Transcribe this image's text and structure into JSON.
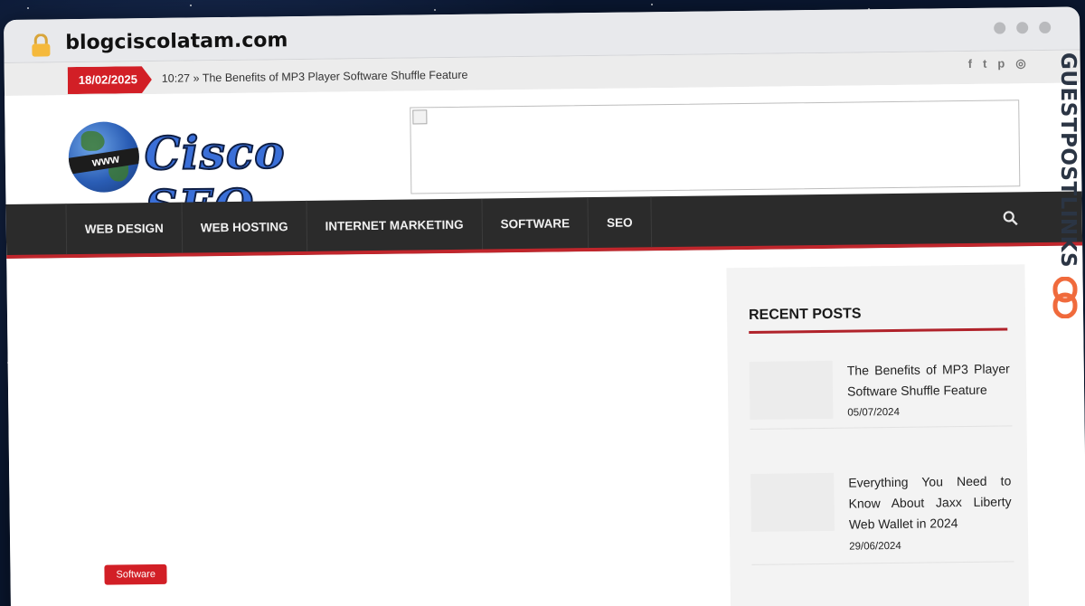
{
  "browser": {
    "domain": "blogciscolatam.com"
  },
  "topbar": {
    "date": "18/02/2025",
    "ticker_time": "10:27",
    "ticker_text": "The Benefits of MP3 Player Software Shuffle Feature",
    "social_icons": [
      "facebook-icon",
      "twitter-icon",
      "pinterest-icon",
      "instagram-icon"
    ]
  },
  "logo": {
    "globe_text": "www",
    "text": "Cisco SEO"
  },
  "nav": {
    "items": [
      {
        "label": "WEB DESIGN"
      },
      {
        "label": "WEB HOSTING"
      },
      {
        "label": "INTERNET MARKETING"
      },
      {
        "label": "SOFTWARE"
      },
      {
        "label": "SEO"
      }
    ]
  },
  "main": {
    "category_tag": "Software"
  },
  "sidebar": {
    "title": "RECENT POSTS",
    "posts": [
      {
        "title": "The Benefits of MP3 Player Software Shuffle Feature",
        "date": "05/07/2024"
      },
      {
        "title": "Everything You Need to Know About Jaxx Liberty Web Wallet in 2024",
        "date": "29/06/2024"
      }
    ]
  },
  "watermark": {
    "text": "GUESTPOSTLINKS"
  },
  "colors": {
    "accent": "#d21f26",
    "nav_bg": "#2b2b2b",
    "logo_blue": "#3a6fd8"
  }
}
